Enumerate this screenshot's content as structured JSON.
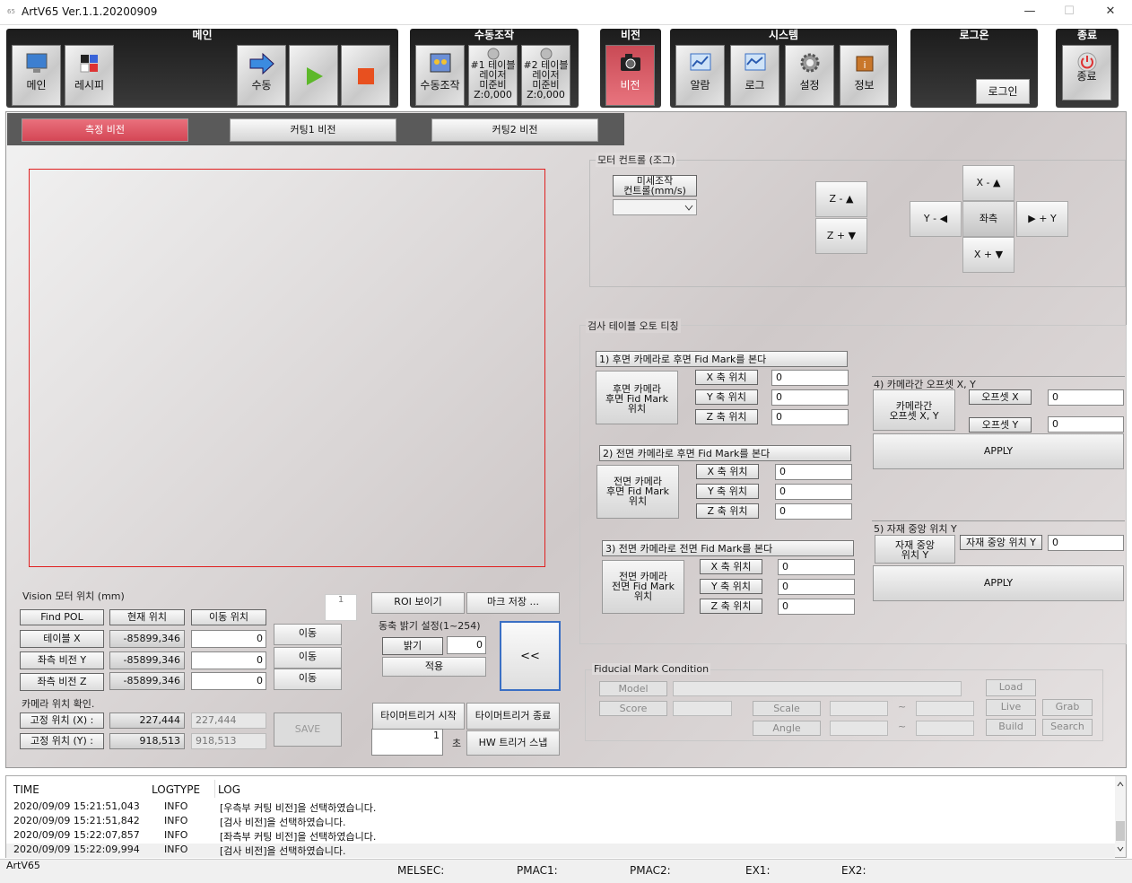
{
  "window": {
    "title": "ArtV65 Ver.1.1.20200909",
    "app_icon": "65",
    "minimize": "—",
    "maximize": "☐",
    "close": "✕"
  },
  "toolbar": {
    "groups": {
      "main": "메인",
      "manual": "수동조작",
      "vision": "비전",
      "system": "시스템",
      "login": "로그온",
      "exit": "종료"
    },
    "main_btn": "메인",
    "recipe_btn": "레시피",
    "manual_btn": "수동",
    "manual_op_btn": "수동조작",
    "table1": {
      "l1": "#1 테이블",
      "l2": "레이저",
      "l3": "미준비",
      "l4": "Z:0,000"
    },
    "table2": {
      "l1": "#2 테이블",
      "l2": "레이저",
      "l3": "미준비",
      "l4": "Z:0,000"
    },
    "vision_btn": "비전",
    "alarm_btn": "알람",
    "log_btn": "로그",
    "settings_btn": "설정",
    "info_btn": "정보",
    "login_btn": "로그인",
    "exit_btn": "종료"
  },
  "tabs": [
    "측정 비전",
    "커팅1 비전",
    "커팅2 비전"
  ],
  "motor": {
    "title": "Vision 모터 위치 (mm)",
    "counter": "1",
    "findpol": "Find POL",
    "cur_hdr": "현재 위치",
    "move_hdr": "이동 위치",
    "rows": [
      {
        "label": "테이블 X",
        "cur": "-85899,346",
        "move": "0",
        "btn": "이동"
      },
      {
        "label": "좌측 비전 Y",
        "cur": "-85899,346",
        "move": "0",
        "btn": "이동"
      },
      {
        "label": "좌측 비전 Z",
        "cur": "-85899,346",
        "move": "0",
        "btn": "이동"
      }
    ],
    "cam_title": "카메라 위치 확인.",
    "fixed": [
      {
        "label": "고정 위치 (X) :",
        "val": "227,444",
        "val2": "227,444"
      },
      {
        "label": "고정 위치 (Y) :",
        "val": "918,513",
        "val2": "918,513"
      }
    ],
    "save": "SAVE"
  },
  "mid": {
    "roi": "ROI 보이기",
    "mark_save": "마크 저장 ...",
    "bright_title": "동축 밝기 설정(1~254)",
    "bright_lbl": "밝기",
    "bright_val": "0",
    "apply": "적용",
    "collapse": "<<",
    "timer_start": "타이머트리거 시작",
    "timer_end": "타이머트리거 종료",
    "timer_val": "1",
    "sec": "초",
    "hw_snap": "HW 트리거 스냅"
  },
  "jog": {
    "title": "모터 컨트롤 (조그)",
    "fine_l1": "미세조작",
    "fine_l2": "컨트롤(mm/s)",
    "zminus": "Z - ▲",
    "zplus": "Z + ▼",
    "xminus": "X - ▲",
    "yminus": "Y - ◀",
    "center": "좌측",
    "yplus": "▶ + Y",
    "xplus": "X + ▼"
  },
  "teach": {
    "title": "검사 테이블 오토 티칭",
    "s1": {
      "hdr": "1) 후면 카메라로 후면 Fid Mark를 본다",
      "l1": "후면 카메라",
      "l2": "후면 Fid Mark",
      "l3": "위치"
    },
    "s2": {
      "hdr": "2) 전면 카메라로 후면 Fid Mark를 본다",
      "l1": "전면 카메라",
      "l2": "후면 Fid Mark",
      "l3": "위치"
    },
    "s3": {
      "hdr": "3) 전면 카메라로 전면 Fid Mark를 본다",
      "l1": "전면 카메라",
      "l2": "전면 Fid Mark",
      "l3": "위치"
    },
    "xl": "X 축 위치",
    "yl": "Y 축 위치",
    "zl": "Z 축 위치",
    "zero": "0",
    "s4": {
      "hdr": "4) 카메라간 오프셋 X, Y",
      "l1": "카메라간",
      "l2": "오프셋 X, Y",
      "ox": "오프셋 X",
      "oy": "오프셋 Y",
      "vx": "0",
      "vy": "0",
      "apply": "APPLY"
    },
    "s5": {
      "hdr": "5) 자재 중앙 위치 Y",
      "l1": "자재 중앙",
      "l2": "위치 Y",
      "lbl": "자재 중앙 위치 Y",
      "v": "0",
      "apply": "APPLY"
    }
  },
  "fid": {
    "title": "Fiducial Mark Condition",
    "model": "Model",
    "score": "Score",
    "scale": "Scale",
    "angle": "Angle",
    "tilde": "~",
    "load": "Load",
    "live": "Live",
    "grab": "Grab",
    "build": "Build",
    "search": "Search"
  },
  "log": {
    "headers": [
      "TIME",
      "LOGTYPE",
      "LOG"
    ],
    "rows": [
      [
        "2020/09/09 15:21:51,043",
        "INFO",
        "[우측부 커팅 비전]을 선택하였습니다."
      ],
      [
        "2020/09/09 15:21:51,842",
        "INFO",
        "[검사 비전]을 선택하였습니다."
      ],
      [
        "2020/09/09 15:22:07,857",
        "INFO",
        "[좌측부 커팅 비전]을 선택하였습니다."
      ],
      [
        "2020/09/09 15:22:09,994",
        "INFO",
        "[검사 비전]을 선택하였습니다."
      ]
    ]
  },
  "status": {
    "app": "ArtV65",
    "melsec": "MELSEC:",
    "pmac1": "PMAC1:",
    "pmac2": "PMAC2:",
    "ex1": "EX1:",
    "ex2": "EX2:"
  }
}
